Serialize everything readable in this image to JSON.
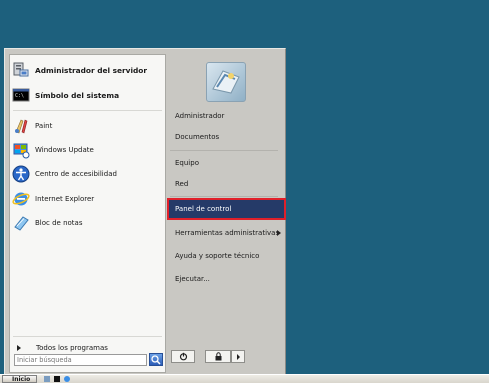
{
  "start_menu": {
    "pinned": [
      {
        "label": "Administrador del servidor",
        "icon": "server-manager-icon"
      },
      {
        "label": "Símbolo del sistema",
        "icon": "command-prompt-icon"
      }
    ],
    "recent": [
      {
        "label": "Paint",
        "icon": "paint-icon"
      },
      {
        "label": "Windows Update",
        "icon": "windows-update-icon"
      },
      {
        "label": "Centro de accesibilidad",
        "icon": "accessibility-icon"
      },
      {
        "label": "Internet Explorer",
        "icon": "internet-explorer-icon"
      },
      {
        "label": "Bloc de notas",
        "icon": "notepad-icon"
      }
    ],
    "all_programs": "Todos los programas",
    "search_placeholder": "Iniciar búsqueda",
    "right": {
      "items": [
        {
          "label": "Administrador"
        },
        {
          "label": "Documentos"
        },
        {
          "label": "Equipo"
        },
        {
          "label": "Red"
        },
        {
          "label": "Panel de control",
          "selected": true
        },
        {
          "label": "Herramientas administrativas",
          "submenu": true
        },
        {
          "label": "Ayuda y soporte técnico"
        },
        {
          "label": "Ejecutar..."
        }
      ]
    }
  },
  "taskbar": {
    "start_label": "Inicio"
  },
  "colors": {
    "desktop": "#1d607d",
    "selection": "#253a68",
    "highlight_border": "#e0202a"
  }
}
